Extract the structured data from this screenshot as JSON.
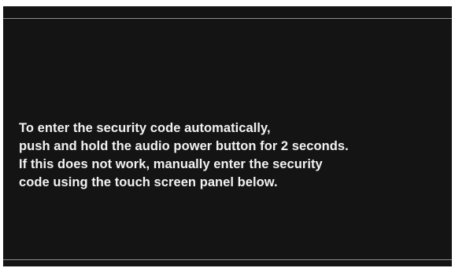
{
  "screen": {
    "message_lines": [
      "To enter the security code automatically,",
      "push and hold the audio power button for 2 seconds.",
      "If this does not work, manually enter the security",
      "code using the touch screen panel below."
    ]
  },
  "colors": {
    "background": "#141414",
    "text": "#f2f2f2",
    "divider": "#8e8e8e",
    "frame": "#ffffff"
  }
}
